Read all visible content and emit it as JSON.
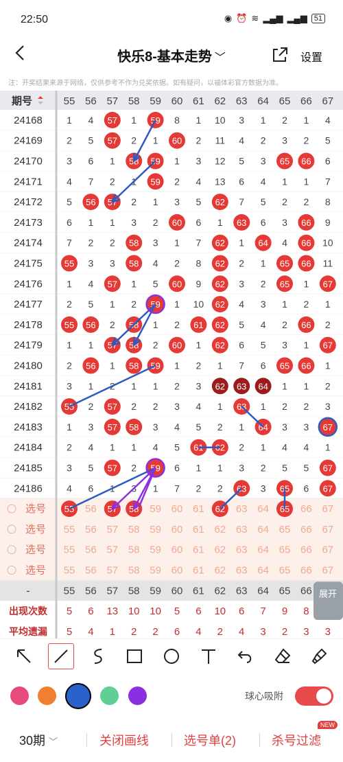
{
  "status": {
    "time": "22:50",
    "battery": "51"
  },
  "nav": {
    "title": "快乐8-基本走势",
    "settings": "设置"
  },
  "notice": "注：开奖结果来源于网络，仅供参考不作为兑奖依据。如有疑问，以福体彩官方数据为准。",
  "table": {
    "period_header": "期号",
    "columns": [
      55,
      56,
      57,
      58,
      59,
      60,
      61,
      62,
      63,
      64,
      65,
      66,
      67
    ],
    "rows": [
      {
        "period": "24168",
        "cells": [
          1,
          4,
          57,
          1,
          59,
          8,
          1,
          10,
          3,
          1,
          2,
          1,
          4
        ]
      },
      {
        "period": "24169",
        "cells": [
          2,
          5,
          57,
          2,
          1,
          60,
          2,
          11,
          4,
          2,
          3,
          2,
          5
        ]
      },
      {
        "period": "24170",
        "cells": [
          3,
          6,
          1,
          58,
          59,
          1,
          3,
          12,
          5,
          3,
          65,
          66,
          6
        ]
      },
      {
        "period": "24171",
        "cells": [
          4,
          7,
          2,
          1,
          59,
          2,
          4,
          13,
          6,
          4,
          1,
          1,
          7
        ]
      },
      {
        "period": "24172",
        "cells": [
          5,
          56,
          57,
          2,
          1,
          3,
          5,
          62,
          7,
          5,
          2,
          2,
          8
        ]
      },
      {
        "period": "24173",
        "cells": [
          6,
          1,
          1,
          3,
          2,
          60,
          6,
          1,
          63,
          6,
          3,
          66,
          9
        ]
      },
      {
        "period": "24174",
        "cells": [
          7,
          2,
          2,
          58,
          3,
          1,
          7,
          62,
          1,
          64,
          4,
          66,
          10
        ]
      },
      {
        "period": "24175",
        "cells": [
          55,
          3,
          3,
          58,
          4,
          2,
          8,
          62,
          2,
          1,
          65,
          66,
          11
        ]
      },
      {
        "period": "24176",
        "cells": [
          1,
          4,
          57,
          1,
          5,
          60,
          9,
          62,
          3,
          2,
          65,
          1,
          67
        ]
      },
      {
        "period": "24177",
        "cells": [
          2,
          5,
          1,
          2,
          59,
          1,
          10,
          62,
          4,
          3,
          1,
          2,
          1
        ]
      },
      {
        "period": "24178",
        "cells": [
          55,
          56,
          2,
          58,
          1,
          2,
          61,
          62,
          5,
          4,
          2,
          66,
          2
        ]
      },
      {
        "period": "24179",
        "cells": [
          1,
          1,
          57,
          58,
          2,
          60,
          1,
          62,
          6,
          5,
          3,
          1,
          67
        ]
      },
      {
        "period": "24180",
        "cells": [
          2,
          56,
          1,
          58,
          59,
          1,
          2,
          1,
          7,
          6,
          65,
          66,
          1
        ]
      },
      {
        "period": "24181",
        "cells": [
          3,
          1,
          2,
          1,
          1,
          2,
          3,
          62,
          63,
          64,
          1,
          1,
          2
        ]
      },
      {
        "period": "24182",
        "cells": [
          55,
          2,
          57,
          2,
          2,
          3,
          4,
          1,
          63,
          1,
          2,
          2,
          3
        ]
      },
      {
        "period": "24183",
        "cells": [
          1,
          3,
          57,
          58,
          3,
          4,
          5,
          2,
          1,
          64,
          3,
          3,
          67
        ]
      },
      {
        "period": "24184",
        "cells": [
          2,
          4,
          1,
          1,
          4,
          5,
          61,
          62,
          2,
          1,
          4,
          4,
          1
        ]
      },
      {
        "period": "24185",
        "cells": [
          3,
          5,
          57,
          2,
          59,
          6,
          1,
          1,
          3,
          2,
          5,
          5,
          67
        ]
      },
      {
        "period": "24186",
        "cells": [
          4,
          6,
          1,
          3,
          1,
          7,
          2,
          2,
          63,
          3,
          65,
          6,
          67
        ]
      }
    ],
    "dark_row": "24181",
    "select_label": "选号",
    "select_selected": [
      55,
      57,
      58,
      62,
      65
    ],
    "summary": [
      {
        "label": "-",
        "values": [
          55,
          56,
          57,
          58,
          59,
          60,
          61,
          62,
          63,
          64,
          65,
          66,
          67
        ]
      },
      {
        "label": "出现次数",
        "values": [
          5,
          6,
          13,
          10,
          10,
          5,
          6,
          10,
          6,
          7,
          9,
          8,
          7
        ]
      },
      {
        "label": "平均遗漏",
        "values": [
          5,
          4,
          1,
          2,
          2,
          6,
          4,
          2,
          4,
          3,
          2,
          3,
          3
        ]
      }
    ],
    "expand_label": "展开"
  },
  "tools": [
    "arrow-tool",
    "line-tool",
    "curve-tool",
    "rect-tool",
    "circle-tool",
    "text-tool",
    "undo-tool",
    "eraser-tool",
    "clear-tool"
  ],
  "colors": [
    "#e94a7c",
    "#f08030",
    "#2a62c9",
    "#5fcf94",
    "#8a30e0"
  ],
  "magnet_label": "球心吸附",
  "bottom": {
    "periods": "30期",
    "close_lines": "关闭画线",
    "selection": "选号单(2)",
    "filter": "杀号过滤",
    "new_tag": "NEW"
  }
}
